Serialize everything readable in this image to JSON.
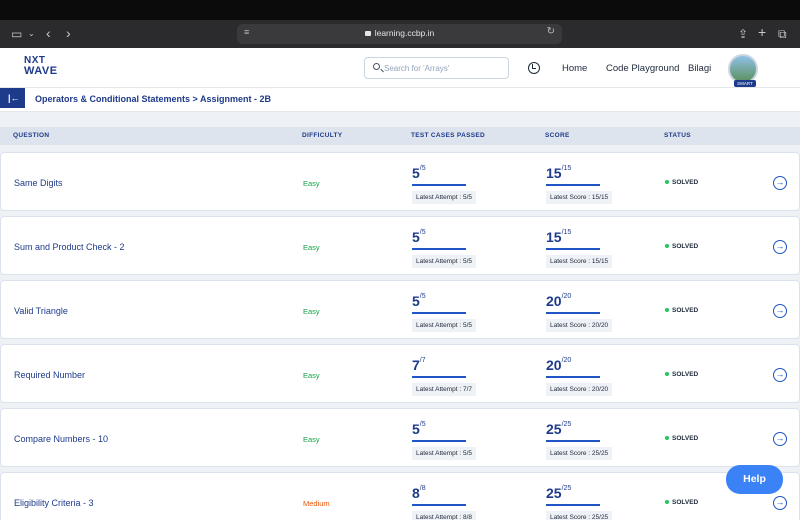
{
  "browser": {
    "url": "learning.ccbp.in"
  },
  "header": {
    "logo_line1": "NXT",
    "logo_line2": "WAVE",
    "search_placeholder": "Search for 'Arrays'",
    "nav_home": "Home",
    "nav_code_playground": "Code Playground",
    "user_name": "Bilagi",
    "avatar_badge": "SMART"
  },
  "breadcrumb": {
    "toggle_glyph": "|←",
    "text": "Operators & Conditional Statements > Assignment - 2B"
  },
  "table": {
    "headers": {
      "question": "QUESTION",
      "difficulty": "DIFFICULTY",
      "test_cases": "TEST CASES PASSED",
      "score": "SCORE",
      "status": "STATUS"
    },
    "rows": [
      {
        "name": "Same Digits",
        "difficulty": "Easy",
        "tc_passed": "5",
        "tc_total": "/5",
        "tc_latest": "Latest Attempt : 5/5",
        "score": "15",
        "score_total": "/15",
        "score_latest": "Latest Score : 15/15",
        "status": "SOLVED"
      },
      {
        "name": "Sum and Product Check - 2",
        "difficulty": "Easy",
        "tc_passed": "5",
        "tc_total": "/5",
        "tc_latest": "Latest Attempt : 5/5",
        "score": "15",
        "score_total": "/15",
        "score_latest": "Latest Score : 15/15",
        "status": "SOLVED"
      },
      {
        "name": "Valid Triangle",
        "difficulty": "Easy",
        "tc_passed": "5",
        "tc_total": "/5",
        "tc_latest": "Latest Attempt : 5/5",
        "score": "20",
        "score_total": "/20",
        "score_latest": "Latest Score : 20/20",
        "status": "SOLVED"
      },
      {
        "name": "Required Number",
        "difficulty": "Easy",
        "tc_passed": "7",
        "tc_total": "/7",
        "tc_latest": "Latest Attempt : 7/7",
        "score": "20",
        "score_total": "/20",
        "score_latest": "Latest Score : 20/20",
        "status": "SOLVED"
      },
      {
        "name": "Compare Numbers - 10",
        "difficulty": "Easy",
        "tc_passed": "5",
        "tc_total": "/5",
        "tc_latest": "Latest Attempt : 5/5",
        "score": "25",
        "score_total": "/25",
        "score_latest": "Latest Score : 25/25",
        "status": "SOLVED"
      },
      {
        "name": "Eligibility Criteria - 3",
        "difficulty": "Medium",
        "tc_passed": "8",
        "tc_total": "/8",
        "tc_latest": "Latest Attempt : 8/8",
        "score": "25",
        "score_total": "/25",
        "score_latest": "Latest Score : 25/25",
        "status": "SOLVED"
      }
    ]
  },
  "help_button": "Help",
  "colors": {
    "brand": "#1e3a8a",
    "accent": "#3b82f6",
    "easy": "#16a34a",
    "medium": "#ea580c",
    "solved_dot": "#22c55e"
  }
}
